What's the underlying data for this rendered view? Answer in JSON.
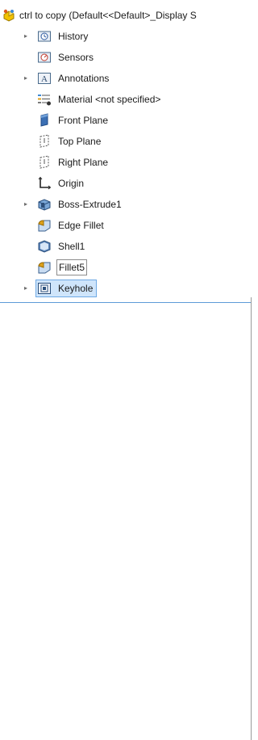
{
  "root": {
    "label": "ctrl to copy  (Default<<Default>_Display S",
    "icon": "part-icon"
  },
  "items": [
    {
      "label": "History",
      "icon": "history-icon",
      "expandable": true
    },
    {
      "label": "Sensors",
      "icon": "sensors-icon",
      "expandable": false
    },
    {
      "label": "Annotations",
      "icon": "annotations-icon",
      "expandable": true
    },
    {
      "label": "Material <not specified>",
      "icon": "material-icon",
      "expandable": false
    },
    {
      "label": "Front Plane",
      "icon": "front-plane-icon",
      "expandable": false
    },
    {
      "label": "Top Plane",
      "icon": "top-plane-icon",
      "expandable": false
    },
    {
      "label": "Right Plane",
      "icon": "right-plane-icon",
      "expandable": false
    },
    {
      "label": "Origin",
      "icon": "origin-icon",
      "expandable": false
    },
    {
      "label": "Boss-Extrude1",
      "icon": "boss-extrude-icon",
      "expandable": true
    },
    {
      "label": "Edge Fillet",
      "icon": "fillet-icon",
      "expandable": false
    },
    {
      "label": "Shell1",
      "icon": "shell-icon",
      "expandable": false
    },
    {
      "label": "Fillet5",
      "icon": "fillet-icon",
      "expandable": false,
      "boxed": true
    },
    {
      "label": "Keyhole",
      "icon": "keyhole-icon",
      "expandable": true,
      "selected": true
    }
  ],
  "colors": {
    "selection": "#cfe5fb",
    "selection_border": "#6fa9e4",
    "accent": "#5e9bd8"
  }
}
